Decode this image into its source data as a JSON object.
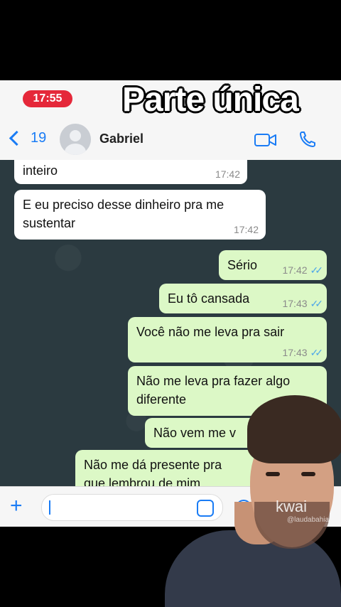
{
  "status_bar": {
    "time": "17:55"
  },
  "overlay_title": "Parte única",
  "header": {
    "back_count": "19",
    "contact_name": "Gabriel"
  },
  "messages": [
    {
      "dir": "in",
      "text": "inteiro",
      "time": "17:42"
    },
    {
      "dir": "in",
      "text": "E eu preciso desse dinheiro pra me\nsustentar",
      "time": "17:42"
    },
    {
      "dir": "out",
      "text": "Sério",
      "time": "17:42"
    },
    {
      "dir": "out",
      "text": "Eu tô cansada",
      "time": "17:43"
    },
    {
      "dir": "out",
      "text": "Você não me leva pra sair",
      "time": "17:43"
    },
    {
      "dir": "out",
      "text": "Não me leva pra fazer algo\ndiferente",
      "time": ""
    },
    {
      "dir": "out",
      "text": "Não vem me v",
      "time": ""
    },
    {
      "dir": "out",
      "text": "Não me dá presente pra\nque lembrou de mim",
      "time": ""
    }
  ],
  "watermark": {
    "brand": "kwai",
    "handle": "@laudabahia"
  },
  "colors": {
    "accent": "#1a7cf5",
    "time_pill": "#e5283a",
    "outgoing": "#dcf8c6",
    "incoming": "#ffffff",
    "chat_bg": "#2b3a40"
  },
  "icons": [
    "chevron-left-icon",
    "avatar-icon",
    "video-icon",
    "phone-icon",
    "plus-icon",
    "sticker-icon"
  ]
}
